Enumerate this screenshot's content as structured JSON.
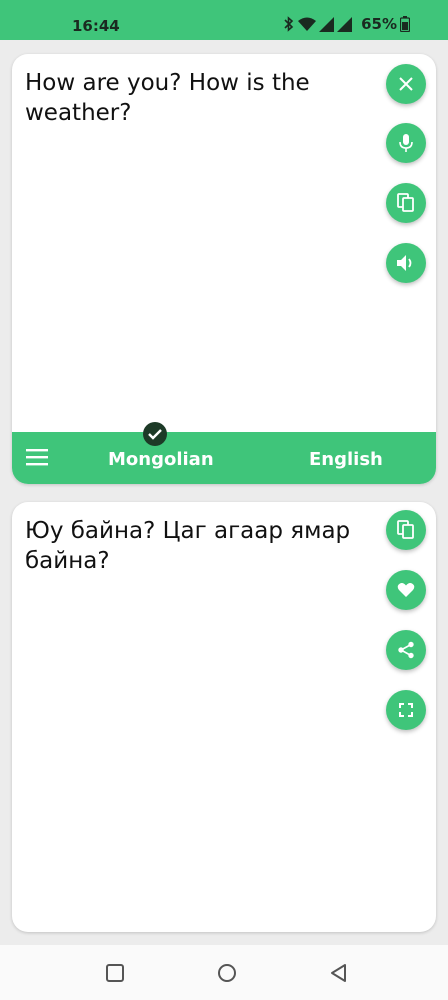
{
  "status_bar": {
    "time": "16:44",
    "battery": "65%",
    "icons": [
      "bluetooth-icon",
      "wifi-icon",
      "signal-icon",
      "signal-icon",
      "battery-icon"
    ]
  },
  "source": {
    "text": "How are you? How is the weather?",
    "actions": [
      "close-icon",
      "microphone-icon",
      "copy-icon",
      "speaker-icon"
    ]
  },
  "language_bar": {
    "source_language": "Mongolian",
    "target_language": "English"
  },
  "target": {
    "text": "Юу байна? Цаг агаар ямар байна?",
    "actions": [
      "copy-icon",
      "heart-icon",
      "share-icon",
      "fullscreen-icon"
    ]
  },
  "colors": {
    "accent": "#3fc57a",
    "badge": "#1d3a27",
    "background": "#ececec"
  }
}
